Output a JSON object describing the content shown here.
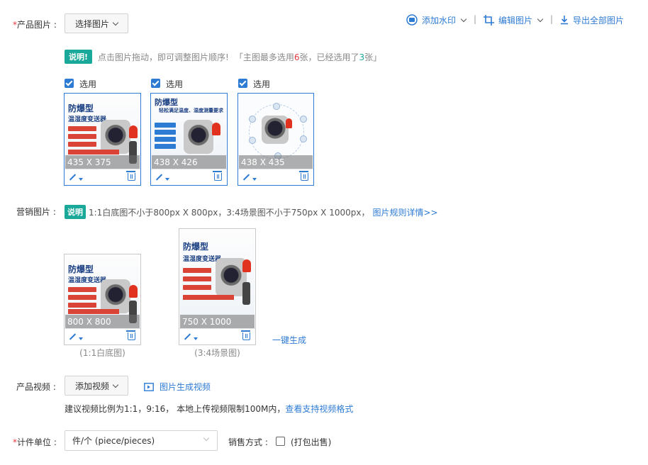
{
  "product_images": {
    "required_mark": "*",
    "label": "产品图片 :",
    "select_button": "选择图片",
    "toolbar": {
      "watermark": "添加水印",
      "edit": "编辑图片",
      "export": "导出全部图片",
      "separator": "|"
    },
    "notice": {
      "badge": "说明!",
      "text_before": "点击图片拖动，即可调整图片顺序!",
      "quote_open": "「主图最多选用",
      "max": "6",
      "mid": "张，已经选用了",
      "count": "3",
      "quote_close": "张」"
    },
    "images": [
      {
        "checkbox_label": "选用",
        "dimensions": "435 X 375",
        "title": "防爆型",
        "subtitle": "温湿度变送器"
      },
      {
        "checkbox_label": "选用",
        "dimensions": "438 X 426",
        "title": "防爆型",
        "subtitle": "轻松满足温度、湿度测量要求"
      },
      {
        "checkbox_label": "选用",
        "dimensions": "438 X 435",
        "title": "",
        "subtitle": ""
      }
    ]
  },
  "marketing_images": {
    "label": "营销图片 :",
    "badge": "说明",
    "text": "1:1白底图不小于800px X 800px，3:4场景图不小于750px X 1000px，",
    "rules_link": "图片规则详情>>",
    "images": [
      {
        "dimensions": "800 X 800",
        "caption": "(1:1白底图)",
        "title": "防爆型",
        "subtitle": "温湿度变送器"
      },
      {
        "dimensions": "750 X 1000",
        "caption": "(3:4场景图)",
        "title": "防爆型",
        "subtitle": "温湿度变送器"
      }
    ],
    "generate_link": "一键生成"
  },
  "product_video": {
    "label": "产品视频 :",
    "add_button": "添加视频",
    "generate_link": "图片生成视频",
    "hint": "建议视频比例为1:1，9:16， 本地上传视频限制100M内，",
    "formats_link": "查看支持视频格式"
  },
  "unit": {
    "required_mark": "*",
    "label": "计件单位 :",
    "value": "件/个 (piece/pieces)",
    "sales_label": "销售方式 :",
    "sales_option": "(打包出售)"
  },
  "colors": {
    "accent": "#2e7bd4",
    "badge": "#1aa89a",
    "required": "#e4393c"
  }
}
